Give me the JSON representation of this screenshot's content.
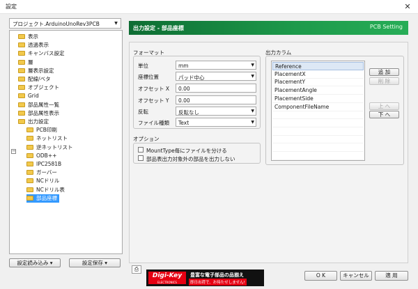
{
  "window": {
    "title": "設定",
    "close_glyph": "✕"
  },
  "project_selector": {
    "value": "プロジェクト.ArduinoUnoRev3PCB"
  },
  "tree": {
    "items": [
      {
        "label": "表示"
      },
      {
        "label": "透過表示"
      },
      {
        "label": "キャンバス設定"
      },
      {
        "label": "層"
      },
      {
        "label": "層表示設定"
      },
      {
        "label": "配線/ベタ"
      },
      {
        "label": "オブジェクト"
      },
      {
        "label": "Grid"
      },
      {
        "label": "部品属性一覧"
      },
      {
        "label": "部品属性表示"
      },
      {
        "label": "出力設定",
        "expanded": true
      }
    ],
    "children": [
      {
        "label": "PCB印刷"
      },
      {
        "label": "ネットリスト"
      },
      {
        "label": "逆ネットリスト"
      },
      {
        "label": "ODB++"
      },
      {
        "label": "IPC2581B"
      },
      {
        "label": "ガーバー"
      },
      {
        "label": "NCドリル"
      },
      {
        "label": "NCドリル表"
      },
      {
        "label": "部品座標",
        "selected": true
      }
    ]
  },
  "left_buttons": {
    "load": "設定読み込み ▾",
    "save": "設定保存 ▾"
  },
  "header": {
    "title": "出力設定 - 部品座標",
    "tag": "PCB Setting",
    "accent": "#1d9a4b"
  },
  "format": {
    "group_label": "フォーマット",
    "unit": {
      "label": "単位",
      "value": "mm"
    },
    "coord": {
      "label": "座標位置",
      "value": "パッド中心"
    },
    "offset_x": {
      "label": "オフセット X",
      "value": "0.00"
    },
    "offset_y": {
      "label": "オフセット Y",
      "value": "0.00"
    },
    "flip": {
      "label": "反転",
      "value": "反転なし"
    },
    "filetype": {
      "label": "ファイル種類",
      "value": "Text"
    }
  },
  "options": {
    "group_label": "オプション",
    "opt1": "MountType毎にファイルを分ける",
    "opt2": "部品表出力対象外の部品を出力しない"
  },
  "columns": {
    "group_label": "出力カラム",
    "items": [
      "Reference",
      "PlacementX",
      "PlacementY",
      "PlacementAngle",
      "PlacementSide",
      "ComponentFileName"
    ],
    "add": "追 加",
    "remove": "削 除",
    "up": "上 へ",
    "down": "下 へ"
  },
  "footer": {
    "ok": "O K",
    "cancel": "キャンセル",
    "apply": "適 用"
  },
  "ad": {
    "logo": "Digi-Key",
    "logo_sub": "ELECTRONICS",
    "line1": "豊富な電子部品の品揃え",
    "line2": "即日出荷で、お待たせしません!"
  },
  "icons": {
    "printer": "printer-icon"
  }
}
